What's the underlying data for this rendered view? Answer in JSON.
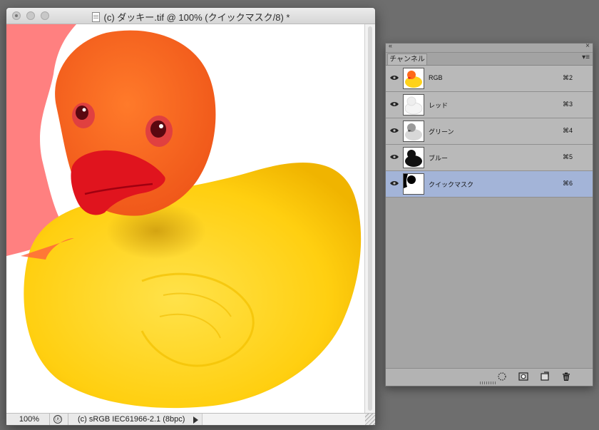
{
  "document": {
    "title": "(c) ダッキー.tif @ 100% (クイックマスク/8) *",
    "zoom": "100%",
    "profile": "(c) sRGB IEC61966-2.1 (8bpc)"
  },
  "panel": {
    "tab_label": "チャンネル",
    "channels": [
      {
        "name": "RGB",
        "shortcut": "⌘2",
        "visible": true,
        "selected": false
      },
      {
        "name": "レッド",
        "shortcut": "⌘3",
        "visible": true,
        "selected": false
      },
      {
        "name": "グリーン",
        "shortcut": "⌘4",
        "visible": true,
        "selected": false
      },
      {
        "name": "ブルー",
        "shortcut": "⌘5",
        "visible": true,
        "selected": false
      },
      {
        "name": "クイックマスク",
        "shortcut": "⌘6",
        "visible": true,
        "selected": true
      }
    ],
    "footer_icons": [
      "load-selection-icon",
      "save-selection-icon",
      "new-channel-icon",
      "trash-icon"
    ]
  },
  "colors": {
    "desktop": "#6e6e6e",
    "quickmask_overlay": "#ff8080",
    "duck_yellow": "#ffd21a",
    "duck_orange": "#ff6a1a",
    "beak_red": "#e0141e",
    "selected_row": "#a3b4d8"
  }
}
